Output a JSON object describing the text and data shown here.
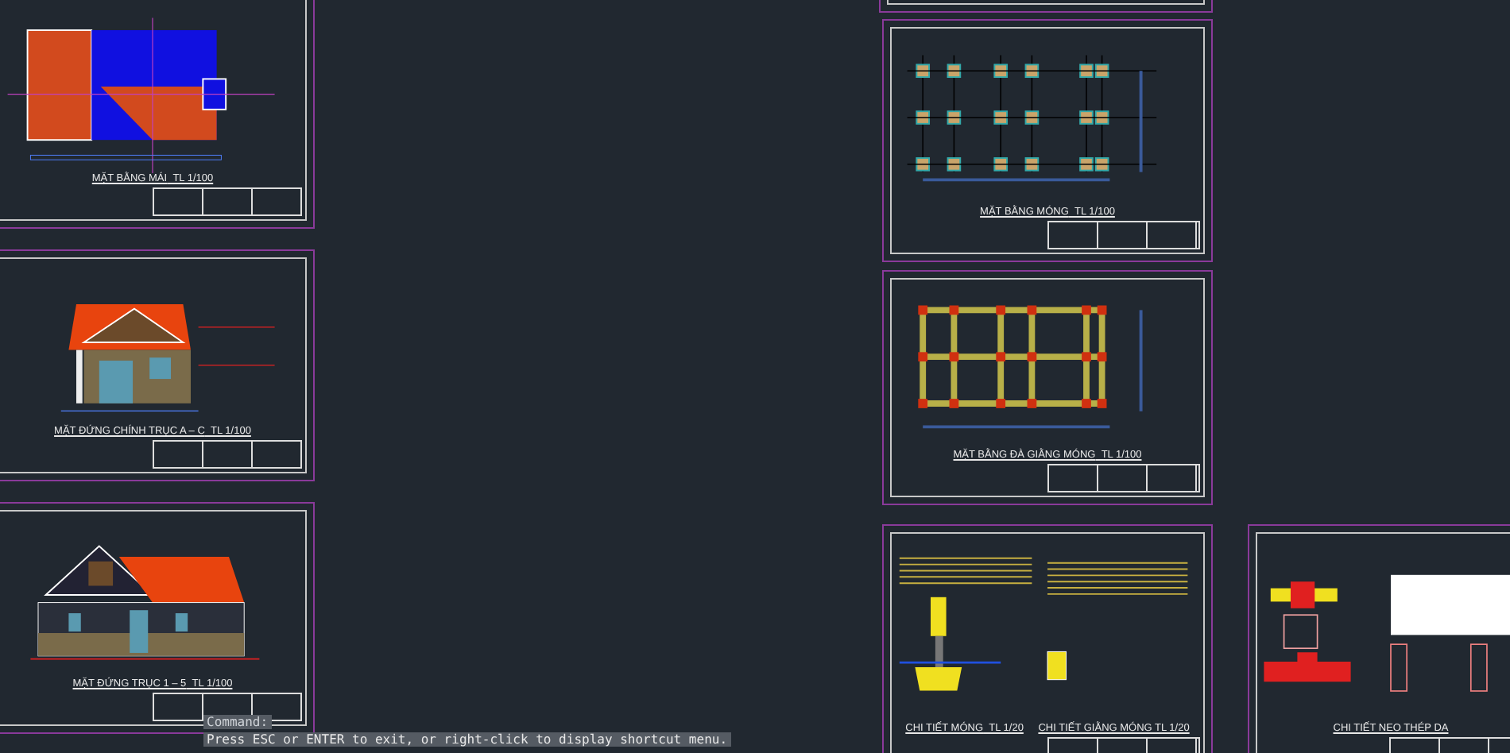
{
  "sheets": [
    {
      "kind": "roof-plan",
      "title": "MẶT BẰNG MÁI",
      "scale": "TL 1/100"
    },
    {
      "kind": "front-elevation",
      "title": "MẶT ĐỨNG CHÍNH TRỤC A – C",
      "scale": "TL 1/100"
    },
    {
      "kind": "side-elevation",
      "title": "MẶT ĐỨNG TRỤC 1 – 5",
      "scale": "TL 1/100"
    },
    {
      "kind": "blank"
    },
    {
      "kind": "foundation-plan",
      "title": "MẶT BẰNG MÓNG",
      "scale": "TL 1/100"
    },
    {
      "kind": "beam-plan",
      "title": "MẶT BẰNG ĐÀ GIẰNG MÓNG",
      "scale": "TL 1/100"
    },
    {
      "kind": "footing-detail",
      "title": "CHI TIẾT MÓNG",
      "scale": "TL 1/20",
      "title_2": "CHI TIẾT GIẰNG MÓNG  TL 1/20"
    },
    {
      "kind": "rebar-detail",
      "title": "CHI TIẾT NEO THÉP DA"
    }
  ],
  "command_line": {
    "prompt": "Command:",
    "message": "Press ESC or ENTER to exit, or right-click to display shortcut menu."
  }
}
